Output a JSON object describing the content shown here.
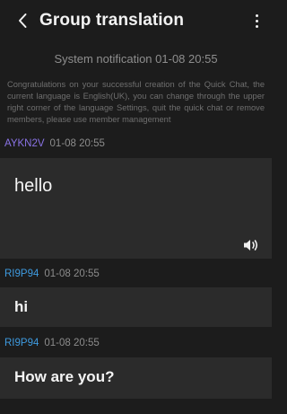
{
  "header": {
    "title": "Group translation",
    "back_icon": "chevron-left-icon",
    "menu_icon": "more-vertical-icon"
  },
  "system": {
    "title": "System notification 01-08 20:55",
    "text": "Congratulations on your successful creation of the Quick Chat, the current language is English(UK), you can change through the upper right corner of the language Settings, quit the quick chat or remove members, please use member management"
  },
  "messages": [
    {
      "sender": "AYKN2V",
      "time": "01-08 20:55",
      "text": "hello",
      "sender_color": "#8a73e6",
      "has_speaker": true
    },
    {
      "sender": "RI9P94",
      "time": "01-08 20:55",
      "text": "hi",
      "sender_color": "#3e9adf"
    },
    {
      "sender": "RI9P94",
      "time": "01-08 20:55",
      "text": "How are you?",
      "sender_color": "#3e9adf"
    }
  ],
  "colors": {
    "background": "#1c1c1c",
    "bubble": "#2b2b2b"
  }
}
